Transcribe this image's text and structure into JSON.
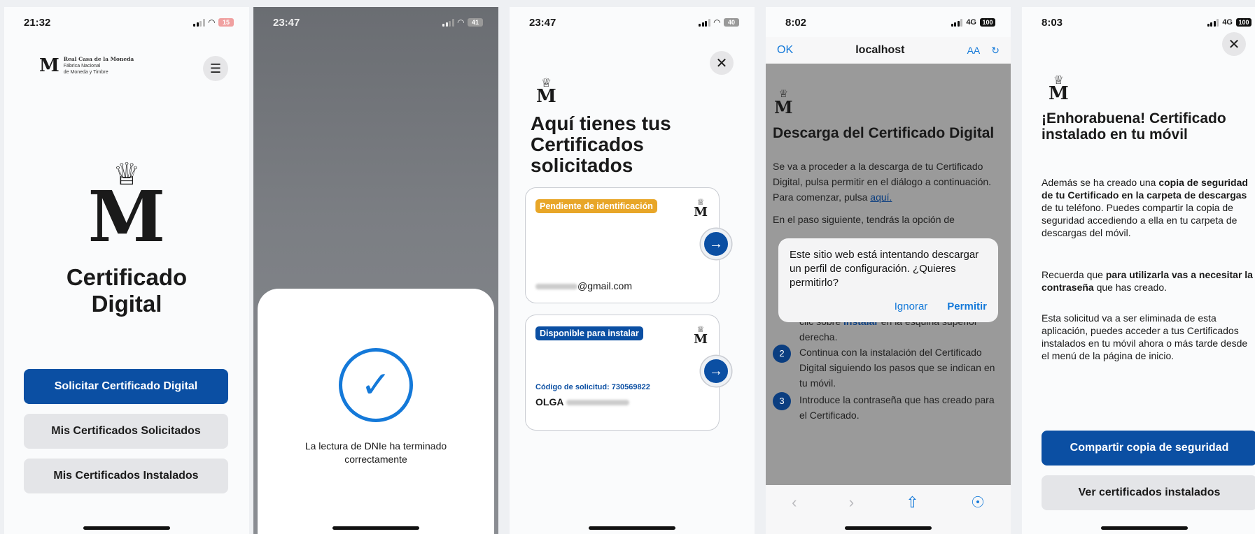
{
  "screen1": {
    "time": "21:32",
    "battery": "15",
    "brand_monogram": "M",
    "brand_line1": "Real Casa de la Moneda",
    "brand_line2": "Fábrica Nacional",
    "brand_line3": "de Moneda y Timbre",
    "big_monogram": "M",
    "title": "Certificado Digital",
    "buttons": {
      "request": "Solicitar Certificado Digital",
      "requested": "Mis Certificados Solicitados",
      "installed": "Mis Certificados Instalados"
    }
  },
  "screen2": {
    "time": "23:47",
    "battery": "41",
    "message": "La lectura de DNIe ha terminado correctamente"
  },
  "screen3": {
    "time": "23:47",
    "battery": "40",
    "monogram": "M",
    "title": "Aquí tienes tus Certificados solicitados",
    "cards": [
      {
        "badge": "Pendiente de identificación",
        "email": "@gmail.com"
      },
      {
        "badge": "Disponible para instalar",
        "code": "Código de solicitud: 730569822",
        "name": "OLGA"
      }
    ]
  },
  "screen4": {
    "time": "8:02",
    "network": "4G",
    "battery": "100",
    "ok": "OK",
    "host": "localhost",
    "text_size": "AA",
    "monogram": "M",
    "heading": "Descarga del Certificado Digital",
    "intro": "Se va a proceder a la descarga de tu Certificado Digital, pulsa permitir en el diálogo a continuación. Para comenzar, pulsa",
    "intro_link": "aquí.",
    "next_step": "En el paso siguiente, tendrás la opción de",
    "step1_pre": "clic sobre",
    "step1_link": "Instalar",
    "step1_post": "en la esquina superior derecha.",
    "step2": "Continua con la instalación del Certificado Digital siguiendo los pasos que se indican en tu móvil.",
    "step3": "Introduce la contraseña que has creado para el Certificado.",
    "step_numbers": [
      "2",
      "3"
    ],
    "dialog": {
      "text": "Este sitio web está intentando descargar un perfil de configuración. ¿Quieres permitirlo?",
      "ignore": "Ignorar",
      "allow": "Permitir"
    }
  },
  "screen5": {
    "time": "8:03",
    "network": "4G",
    "battery": "100",
    "monogram": "M",
    "title": "¡Enhorabuena! Certificado instalado en tu móvil",
    "p1_a": "Además se ha creado una ",
    "p1_b": "copia de seguridad de tu Certificado en la carpeta de descargas",
    "p1_c": " de tu teléfono. Puedes compartir la copia de seguridad accediendo a ella en tu carpeta de descargas del móvil.",
    "p2_a": "Recuerda que ",
    "p2_b": "para utilizarla vas a necesitar la contraseña",
    "p2_c": " que has creado.",
    "p3": "Esta solicitud va a ser eliminada de esta aplicación, puedes acceder a tus Certificados instalados en tu móvil ahora o más tarde desde el menú de la página de inicio.",
    "buttons": {
      "share": "Compartir copia de seguridad",
      "view": "Ver certificados instalados"
    }
  },
  "colors": {
    "primary": "#0b4fa3",
    "link": "#1479d9",
    "pending": "#e8a628",
    "secondary_btn": "#e4e5e8"
  }
}
